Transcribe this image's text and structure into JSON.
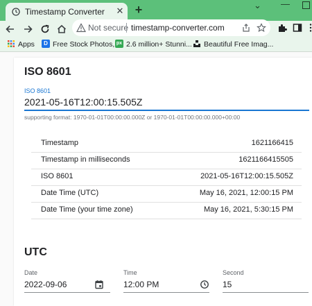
{
  "browser": {
    "tab_title": "Timestamp Converter",
    "tab_close_glyph": "✕",
    "new_tab_glyph": "+",
    "window_dropdown_glyph": "⌄",
    "window_minimize_glyph": "—",
    "security_label": "Not secure",
    "url": "timestamp-converter.com",
    "theme_color": "#5cc07a"
  },
  "bookmarks": [
    {
      "label": "Apps",
      "icon": "apps-grid-icon"
    },
    {
      "label": "Free Stock Photos,...",
      "icon": "D"
    },
    {
      "label": "2.6 million+ Stunni...",
      "icon": "px"
    },
    {
      "label": "Beautiful Free Imag...",
      "icon": "unsplash-icon"
    }
  ],
  "iso_section": {
    "title": "ISO 8601",
    "input_label": "ISO 8601",
    "input_value": "2021-05-16T12:00:15.505Z",
    "hint": "supporting format: 1970-01-01T00:00:00.000Z or 1970-01-01T00:00:00.000+00:00",
    "accent_color": "#1976d2"
  },
  "results": [
    {
      "key": "Timestamp",
      "value": "1621166415"
    },
    {
      "key": "Timestamp in milliseconds",
      "value": "1621166415505"
    },
    {
      "key": "ISO 8601",
      "value": "2021-05-16T12:00:15.505Z"
    },
    {
      "key": "Date Time (UTC)",
      "value": "May 16, 2021, 12:00:15 PM"
    },
    {
      "key": "Date Time (your time zone)",
      "value": "May 16, 2021, 5:30:15 PM"
    }
  ],
  "utc_section": {
    "title": "UTC",
    "date_label": "Date",
    "date_value": "2022-09-06",
    "time_label": "Time",
    "time_value": "12:00 PM",
    "second_label": "Second",
    "second_value": "15"
  }
}
